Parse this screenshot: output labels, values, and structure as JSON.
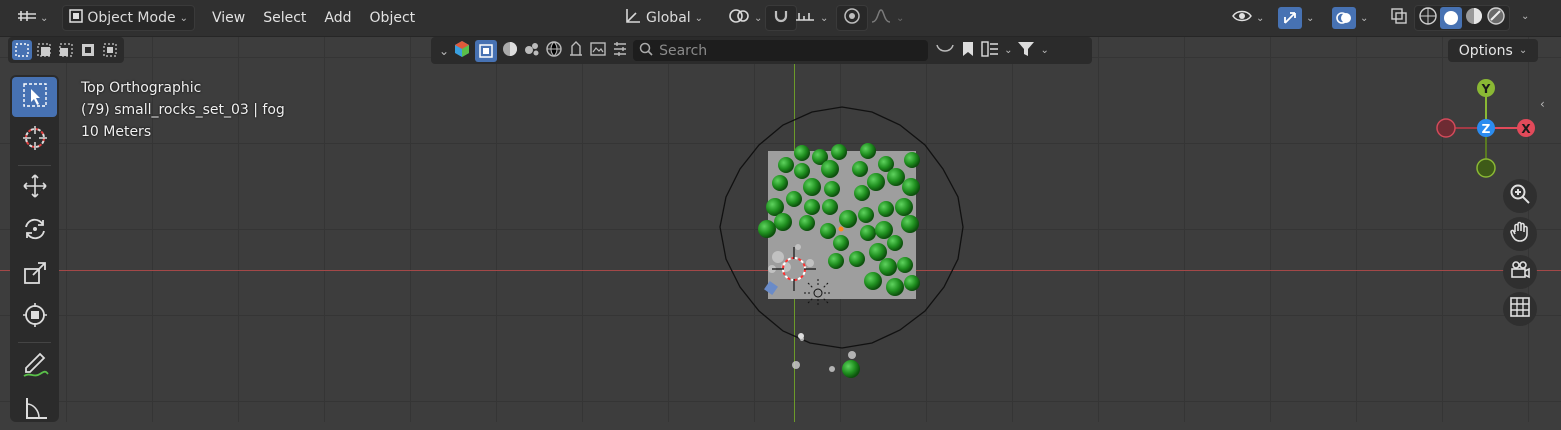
{
  "header": {
    "mode_label": "Object Mode",
    "menus": [
      "View",
      "Select",
      "Add",
      "Object"
    ],
    "transform_orientation": "Global"
  },
  "outliner": {
    "search_placeholder": "Search"
  },
  "options_label": "Options",
  "overlay": {
    "view_name": "Top Orthographic",
    "object_info": "(79) small_rocks_set_03 | fog",
    "scale": "10 Meters"
  },
  "gizmo": {
    "y_label": "Y",
    "z_label": "Z",
    "x_label": "X"
  },
  "colors": {
    "accent": "#4772b3",
    "x_axis": "#a34848",
    "y_axis": "#6c9a2a",
    "sphere_green": "#1f8f1f"
  }
}
